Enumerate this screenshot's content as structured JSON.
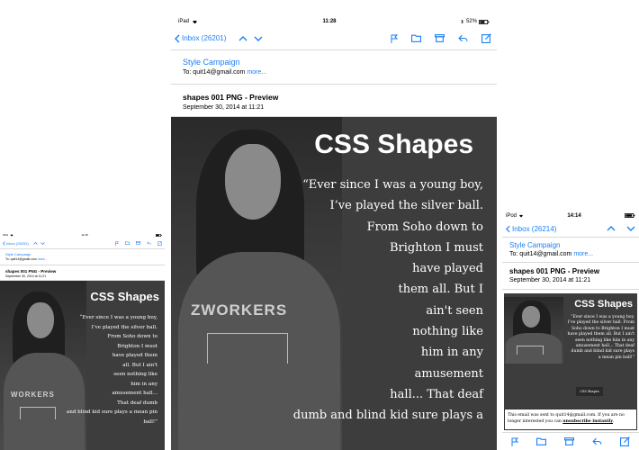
{
  "large": {
    "status": {
      "device": "iPad",
      "time": "11:28",
      "battery": "52%"
    },
    "nav": {
      "back_label": "Inbox (26201)"
    },
    "header": {
      "sender": "Style Campaign",
      "to_prefix": "To:",
      "to": "quit14@gmail.com",
      "more": "more..."
    },
    "subject": "shapes 001 PNG - Preview",
    "date": "September 30, 2014 at 11:21",
    "body": {
      "title": "CSS Shapes",
      "shirt_text": "ZWORKERS",
      "quote_lines": [
        "“Ever since I was a young boy,",
        "I’ve played the silver ball.",
        "From Soho down to",
        "Brighton I must",
        "have played",
        "them all. But I",
        "ain't seen",
        "nothing like",
        "him in any",
        "amusement",
        "hall... That deaf",
        "dumb and blind kid sure plays a"
      ]
    }
  },
  "small": {
    "status": {
      "device": "iPad",
      "time": "11:28"
    },
    "nav": {
      "back_label": "Inbox (26202)"
    },
    "header": {
      "sender": "Style Campaign",
      "to_prefix": "To:",
      "to": "quit14@gmail.com",
      "more": "more..."
    },
    "subject": "shapes 001 PNG - Preview",
    "date": "September 30, 2014 at 11:21",
    "body": {
      "title": "CSS Shapes",
      "shirt_text": "WORKERS",
      "quote_lines": [
        "“Ever since I was a young boy,",
        "I’ve played the silver ball.",
        "From Soho down to",
        "Brighton I must",
        "have played them",
        "all. But I ain't",
        "seen nothing like",
        "him in any",
        "amusement hall...",
        "That deaf dumb",
        "and blind kid sure plays a mean pin",
        "ball!”"
      ]
    }
  },
  "phone": {
    "status": {
      "device": "iPod",
      "time": "14:14",
      "battery": "..."
    },
    "nav": {
      "back_label": "Inbox (26214)"
    },
    "header": {
      "sender": "Style Campaign",
      "to_prefix": "To:",
      "to": "quit14@gmail.com",
      "more": "more..."
    },
    "subject": "shapes 001 PNG - Preview",
    "date": "September 30, 2014 at 11:21",
    "body": {
      "title": "CSS Shapes",
      "quote_lines": [
        "“Ever since I was a young boy,",
        "I’ve played the silver ball. From",
        "Soho down to Brighton I must",
        "have played them all. But I ain't",
        "seen nothing like him in any",
        "amusement hall... That deaf",
        "dumb and blind kid sure plays",
        "a mean pin ball!”"
      ],
      "button_label": "CSS Shapes"
    },
    "footer": {
      "line1": "This email was sent to quit14@gmail.com. If you are no",
      "line2_prefix": "longer interested you can ",
      "unsubscribe": "unsubscribe instantly",
      "line2_suffix": "."
    }
  },
  "colors": {
    "accent": "#1a7ff6",
    "body_bg": "#3d3d3d",
    "text_light": "#ffffff"
  }
}
